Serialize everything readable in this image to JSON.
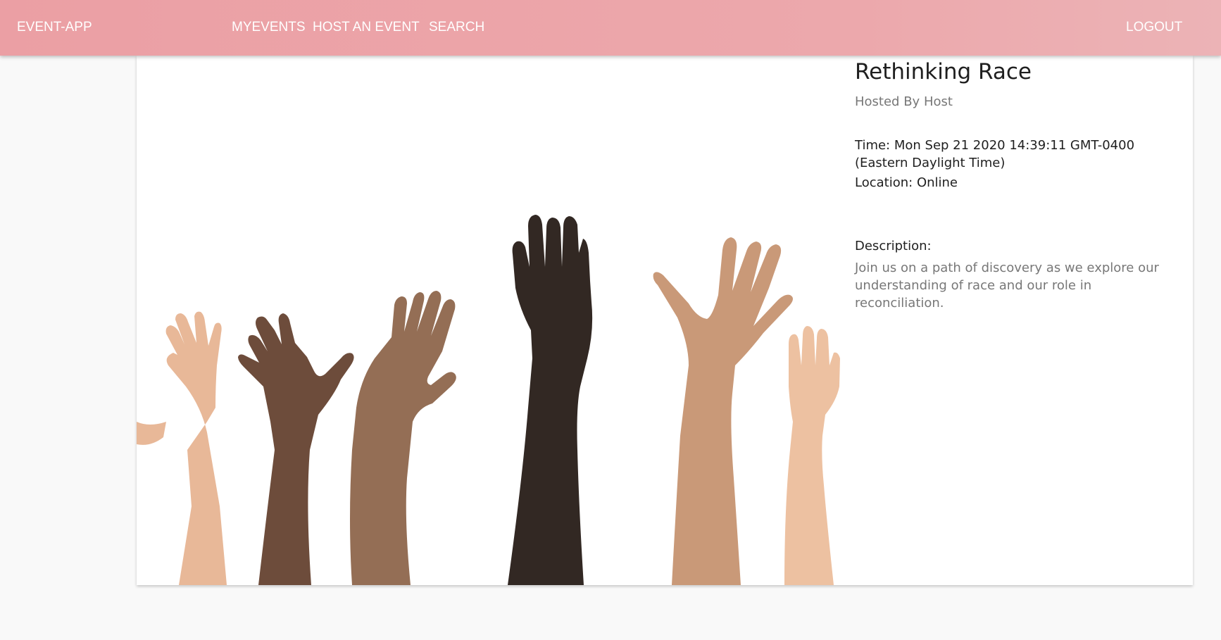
{
  "navbar": {
    "brand": "EVENT-APP",
    "links": [
      "MYEVENTS",
      "HOST AN EVENT",
      "SEARCH"
    ],
    "logout": "LOGOUT",
    "gradient_colors": [
      "#eb9fa4",
      "#ecb3b6"
    ]
  },
  "event": {
    "title": "Rethinking Race",
    "hosted_by_prefix": "Hosted By",
    "host_name": "Host",
    "time_label": "Time:",
    "time_value": "Mon Sep 21 2020 14:39:11 GMT-0400 (Eastern Daylight Time)",
    "location_label": "Location:",
    "location_value": "Online",
    "description_label": "Description:",
    "description": "Join us on a path of discovery as we explore our understanding of race and our role in reconciliation."
  },
  "image": {
    "subject": "raised-hands-illustration",
    "skin_tones": [
      "#e8b898",
      "#6d4c3b",
      "#946e55",
      "#322823",
      "#c99978",
      "#edc1a1"
    ]
  }
}
